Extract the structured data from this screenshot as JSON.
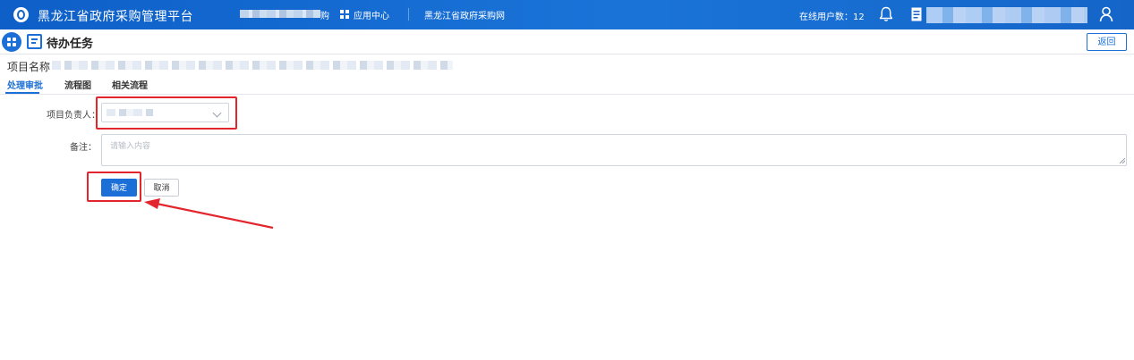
{
  "header": {
    "platform_title": "黑龙江省政府采购管理平台",
    "user_suffix": "购",
    "app_center": "应用中心",
    "site_link": "黑龙江省政府采购网",
    "online_users": "在线用户数：12"
  },
  "page": {
    "title": "待办任务",
    "back_label": "返回",
    "project_name_label": "项目名称"
  },
  "tabs": [
    {
      "label": "处理审批",
      "active": true
    },
    {
      "label": "流程图",
      "active": false
    },
    {
      "label": "相关流程",
      "active": false
    }
  ],
  "form": {
    "owner_label": "项目负责人：",
    "remark_label": "备注：",
    "remark_placeholder": "请输入内容",
    "remark_value": "",
    "confirm_label": "确定",
    "cancel_label": "取消"
  },
  "colors": {
    "primary": "#1b6fd6",
    "annotation_red": "#e3262d"
  },
  "icons": {
    "logo": "platform-logo-icon",
    "apps": "app-grid-icon",
    "bell": "bell-icon",
    "doc": "document-icon",
    "user": "user-icon",
    "menu": "menu-grid-icon",
    "task": "task-icon",
    "dropdown": "chevron-down-icon"
  }
}
